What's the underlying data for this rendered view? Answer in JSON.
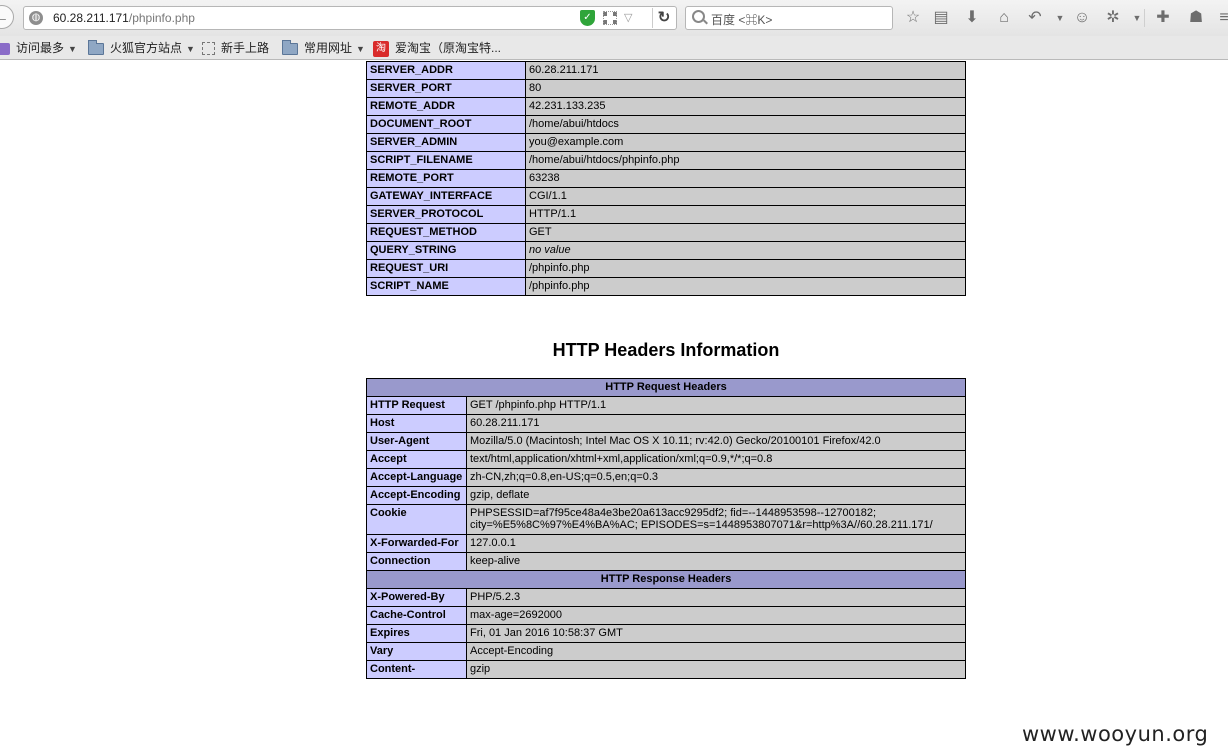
{
  "browser": {
    "url_host": "60.28.211.171",
    "url_path": "/phpinfo.php",
    "search_placeholder": "百度 <⌘K>"
  },
  "bookmarks": [
    {
      "label": "访问最多",
      "icon": "most-visited-icon",
      "has_menu": true
    },
    {
      "label": "火狐官方站点",
      "icon": "folder-icon",
      "has_menu": true
    },
    {
      "label": "新手上路",
      "icon": "dotted-square-icon",
      "has_menu": false
    },
    {
      "label": "常用网址",
      "icon": "folder-icon",
      "has_menu": true
    },
    {
      "label": "爱淘宝（原淘宝特...",
      "icon": "taobao-icon",
      "has_menu": false
    }
  ],
  "env_table": [
    {
      "key": "SERVER_ADDR",
      "value": "60.28.211.171"
    },
    {
      "key": "SERVER_PORT",
      "value": "80"
    },
    {
      "key": "REMOTE_ADDR",
      "value": "42.231.133.235"
    },
    {
      "key": "DOCUMENT_ROOT",
      "value": "/home/abui/htdocs"
    },
    {
      "key": "SERVER_ADMIN",
      "value": "you@example.com"
    },
    {
      "key": "SCRIPT_FILENAME",
      "value": "/home/abui/htdocs/phpinfo.php"
    },
    {
      "key": "REMOTE_PORT",
      "value": "63238"
    },
    {
      "key": "GATEWAY_INTERFACE",
      "value": "CGI/1.1"
    },
    {
      "key": "SERVER_PROTOCOL",
      "value": "HTTP/1.1"
    },
    {
      "key": "REQUEST_METHOD",
      "value": "GET"
    },
    {
      "key": "QUERY_STRING",
      "value": "no value",
      "italic": true
    },
    {
      "key": "REQUEST_URI",
      "value": "/phpinfo.php"
    },
    {
      "key": "SCRIPT_NAME",
      "value": "/phpinfo.php"
    }
  ],
  "headers_section": {
    "title": "HTTP Headers Information",
    "request_header": "HTTP Request Headers",
    "request_rows": [
      {
        "key": "HTTP Request",
        "value": "GET /phpinfo.php HTTP/1.1"
      },
      {
        "key": "Host",
        "value": "60.28.211.171"
      },
      {
        "key": "User-Agent",
        "value": "Mozilla/5.0 (Macintosh; Intel Mac OS X 10.11; rv:42.0) Gecko/20100101 Firefox/42.0"
      },
      {
        "key": "Accept",
        "value": "text/html,application/xhtml+xml,application/xml;q=0.9,*/*;q=0.8"
      },
      {
        "key": "Accept-Language",
        "value": "zh-CN,zh;q=0.8,en-US;q=0.5,en;q=0.3"
      },
      {
        "key": "Accept-Encoding",
        "value": "gzip, deflate"
      },
      {
        "key": "Cookie",
        "value": "PHPSESSID=af7f95ce48a4e3be20a613acc9295df2; fid=--1448953598--12700182; city=%E5%8C%97%E4%BA%AC; EPISODES=s=1448953807071&r=http%3A//60.28.211.171/"
      },
      {
        "key": "X-Forwarded-For",
        "value": "127.0.0.1"
      },
      {
        "key": "Connection",
        "value": "keep-alive"
      }
    ],
    "response_header": "HTTP Response Headers",
    "response_rows": [
      {
        "key": "X-Powered-By",
        "value": "PHP/5.2.3"
      },
      {
        "key": "Cache-Control",
        "value": "max-age=2692000"
      },
      {
        "key": "Expires",
        "value": "Fri, 01 Jan 2016 10:58:37 GMT"
      },
      {
        "key": "Vary",
        "value": "Accept-Encoding"
      },
      {
        "key": "Content-",
        "value": "gzip"
      }
    ]
  },
  "watermark": "www.wooyun.org"
}
